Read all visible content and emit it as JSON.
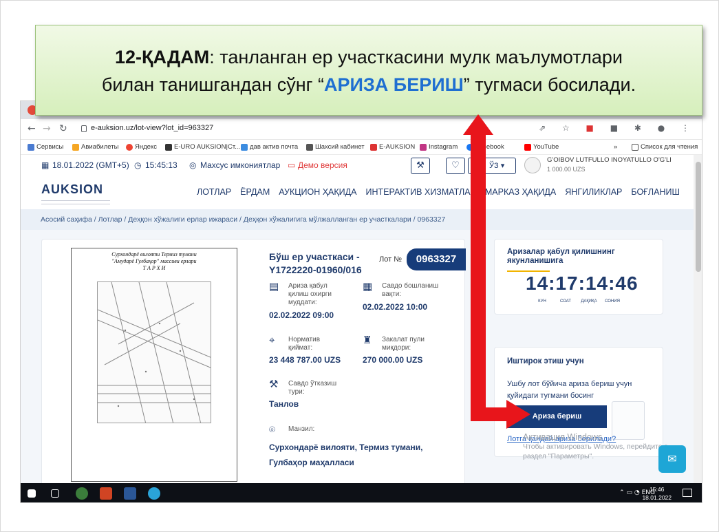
{
  "callout": {
    "step": "12-ҚАДАМ",
    "line1_rest": ": танланган ер участкасини мулк маълумотлари",
    "line2_before": "билан танишгандан сўнг “",
    "line2_highlight": "АРИЗА БЕРИШ",
    "line2_after": "” тугмаси босилади."
  },
  "browser": {
    "url": "e-auksion.uz/lot-view?lot_id=963327",
    "bookmarks": [
      "Сервисы",
      "Авиабилеты",
      "Яндекс",
      "E-URO AUKSION|Ст...",
      "дав актив почта",
      "Шахсий кабинет",
      "E-AUKSION",
      "Instagram",
      "Facebook",
      "YouTube"
    ],
    "reading_list": "Список для чтения",
    "more": "»"
  },
  "site_top": {
    "date": "18.01.2022 (GMT+5)",
    "time": "15:45:13",
    "special": "Махсус имкониятлар",
    "demo": "Демо версия",
    "lang": "ЎЗ",
    "user_name": "G'OIBOV LUTFULLO INOYATULLO O'G'LI",
    "user_balance": "1 000.00 UZS"
  },
  "logo": "AUKSION",
  "menu": [
    "ЛОТЛАР",
    "ЁРДАМ",
    "АУКЦИОН ҲАҚИДА",
    "ИНТЕРАКТИВ ХИЗМАТЛАР",
    "МАРКАЗ ҲАҚИДА",
    "ЯНГИЛИКЛАР",
    "БОҒЛАНИШ"
  ],
  "breadcrumb": [
    "Асосий саҳифа",
    "Лотлар",
    "Деҳқон хўжалиги ерлар ижараси",
    "Деҳқон хўжалигига мўлжалланган ер участкалари",
    "0963327"
  ],
  "doc": {
    "title1": "Сурхондарё вилояти Термиз тумани",
    "title2": "\"Амударё Гулбаҳор\" массиви ерлари",
    "title3": "Т А Р Х И"
  },
  "lot": {
    "title1": "Бўш ер участкаси -",
    "title2": "Y1722220-01960/016",
    "lot_label": "Лот №",
    "lot_number": "0963327",
    "deadline_label1": "Ариза қабул",
    "deadline_label2": "қилиш охирги",
    "deadline_label3": "муддати:",
    "deadline_value": "02.02.2022 09:00",
    "start_label1": "Савдо бошланиш",
    "start_label2": "вақти:",
    "start_value": "02.02.2022 10:00",
    "normative_label1": "Норматив",
    "normative_label2": "қиймат:",
    "normative_value": "23 448 787.00 UZS",
    "deposit_label1": "Закалат пули",
    "deposit_label2": "миқдори:",
    "deposit_value": "270 000.00 UZS",
    "type_label1": "Савдо ўтказиш",
    "type_label2": "тури:",
    "type_value": "Танлов",
    "address_label": "Манзил:",
    "address_line1": "Сурхондарё вилояти, Термиз тумани,",
    "address_line2": "Гулбаҳор маҳалласи"
  },
  "timer": {
    "title1": "Аризалар қабул қилишнинг",
    "title2": "якунланишига",
    "digits": "14:17:14:46",
    "units": [
      "КУН",
      "СОАТ",
      "ДАҚИҚА",
      "СОНИЯ"
    ]
  },
  "participation": {
    "title": "Иштирок этиш учун",
    "text": "Ушбу лот бўйича ариза бериш учун қуйидаги тугмани босинг",
    "button": "Ариза бериш",
    "link": "Лотга қандай ариза берилади?"
  },
  "windows_activation": {
    "title": "Активация Windows",
    "text1": "Чтобы активировать Windows, перейдите в",
    "text2": "раздел \"Параметры\"."
  },
  "taskbar": {
    "lang": "ENG",
    "time": "15:46",
    "date": "18.01.2022"
  },
  "colors": {
    "accent": "#173c7a",
    "highlight": "#1f6fd1",
    "arrow": "#e8151b",
    "callout_bg": "#dff2c9"
  }
}
